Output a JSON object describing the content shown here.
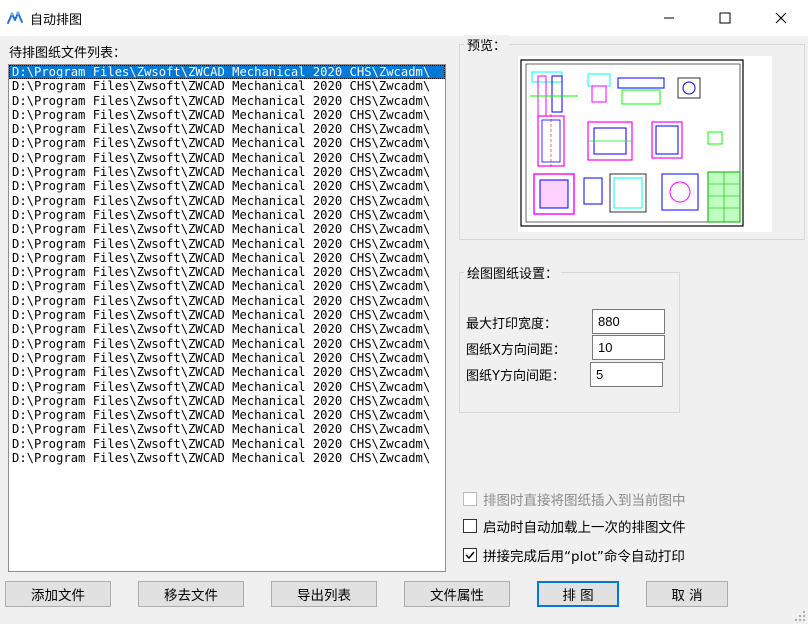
{
  "window": {
    "title": "自动排图",
    "icon": "app-logo-icon",
    "controls": [
      "minimize-icon",
      "maximize-icon",
      "close-icon"
    ]
  },
  "file_list": {
    "label": "待排图纸文件列表：",
    "selected_index": 0,
    "items": [
      "D:\\Program Files\\Zwsoft\\ZWCAD Mechanical 2020 CHS\\Zwcadm\\",
      "D:\\Program Files\\Zwsoft\\ZWCAD Mechanical 2020 CHS\\Zwcadm\\",
      "D:\\Program Files\\Zwsoft\\ZWCAD Mechanical 2020 CHS\\Zwcadm\\",
      "D:\\Program Files\\Zwsoft\\ZWCAD Mechanical 2020 CHS\\Zwcadm\\",
      "D:\\Program Files\\Zwsoft\\ZWCAD Mechanical 2020 CHS\\Zwcadm\\",
      "D:\\Program Files\\Zwsoft\\ZWCAD Mechanical 2020 CHS\\Zwcadm\\",
      "D:\\Program Files\\Zwsoft\\ZWCAD Mechanical 2020 CHS\\Zwcadm\\",
      "D:\\Program Files\\Zwsoft\\ZWCAD Mechanical 2020 CHS\\Zwcadm\\",
      "D:\\Program Files\\Zwsoft\\ZWCAD Mechanical 2020 CHS\\Zwcadm\\",
      "D:\\Program Files\\Zwsoft\\ZWCAD Mechanical 2020 CHS\\Zwcadm\\",
      "D:\\Program Files\\Zwsoft\\ZWCAD Mechanical 2020 CHS\\Zwcadm\\",
      "D:\\Program Files\\Zwsoft\\ZWCAD Mechanical 2020 CHS\\Zwcadm\\",
      "D:\\Program Files\\Zwsoft\\ZWCAD Mechanical 2020 CHS\\Zwcadm\\",
      "D:\\Program Files\\Zwsoft\\ZWCAD Mechanical 2020 CHS\\Zwcadm\\",
      "D:\\Program Files\\Zwsoft\\ZWCAD Mechanical 2020 CHS\\Zwcadm\\",
      "D:\\Program Files\\Zwsoft\\ZWCAD Mechanical 2020 CHS\\Zwcadm\\",
      "D:\\Program Files\\Zwsoft\\ZWCAD Mechanical 2020 CHS\\Zwcadm\\",
      "D:\\Program Files\\Zwsoft\\ZWCAD Mechanical 2020 CHS\\Zwcadm\\",
      "D:\\Program Files\\Zwsoft\\ZWCAD Mechanical 2020 CHS\\Zwcadm\\",
      "D:\\Program Files\\Zwsoft\\ZWCAD Mechanical 2020 CHS\\Zwcadm\\",
      "D:\\Program Files\\Zwsoft\\ZWCAD Mechanical 2020 CHS\\Zwcadm\\",
      "D:\\Program Files\\Zwsoft\\ZWCAD Mechanical 2020 CHS\\Zwcadm\\",
      "D:\\Program Files\\Zwsoft\\ZWCAD Mechanical 2020 CHS\\Zwcadm\\",
      "D:\\Program Files\\Zwsoft\\ZWCAD Mechanical 2020 CHS\\Zwcadm\\",
      "D:\\Program Files\\Zwsoft\\ZWCAD Mechanical 2020 CHS\\Zwcadm\\",
      "D:\\Program Files\\Zwsoft\\ZWCAD Mechanical 2020 CHS\\Zwcadm\\",
      "D:\\Program Files\\Zwsoft\\ZWCAD Mechanical 2020 CHS\\Zwcadm\\",
      "D:\\Program Files\\Zwsoft\\ZWCAD Mechanical 2020 CHS\\Zwcadm\\"
    ]
  },
  "preview": {
    "label": "预览："
  },
  "settings": {
    "label": "绘图图纸设置：",
    "max_width_label": "最大打印宽度：",
    "max_width_value": "880",
    "x_spacing_label": "图纸X方向间距：",
    "x_spacing_value": "10",
    "y_spacing_label": "图纸Y方向间距：",
    "y_spacing_value": "5"
  },
  "options": {
    "insert_direct_label": "排图时直接将图纸插入到当前图中",
    "insert_direct_checked": false,
    "insert_direct_enabled": false,
    "autoload_label": "启动时自动加载上一次的排图文件",
    "autoload_checked": false,
    "autoprint_label": "拼接完成后用“plot”命令自动打印",
    "autoprint_checked": true
  },
  "buttons": {
    "add_file": "添加文件",
    "remove_file": "移去文件",
    "export_list": "导出列表",
    "file_props": "文件属性",
    "arrange": "排 图",
    "cancel": "取 消"
  },
  "colors": {
    "selection": "#0078d7",
    "cad_cyan": "#00ffff",
    "cad_magenta": "#ff00ff",
    "cad_green": "#00ff00",
    "cad_blue": "#0000ff",
    "cad_red": "#ff0000"
  }
}
